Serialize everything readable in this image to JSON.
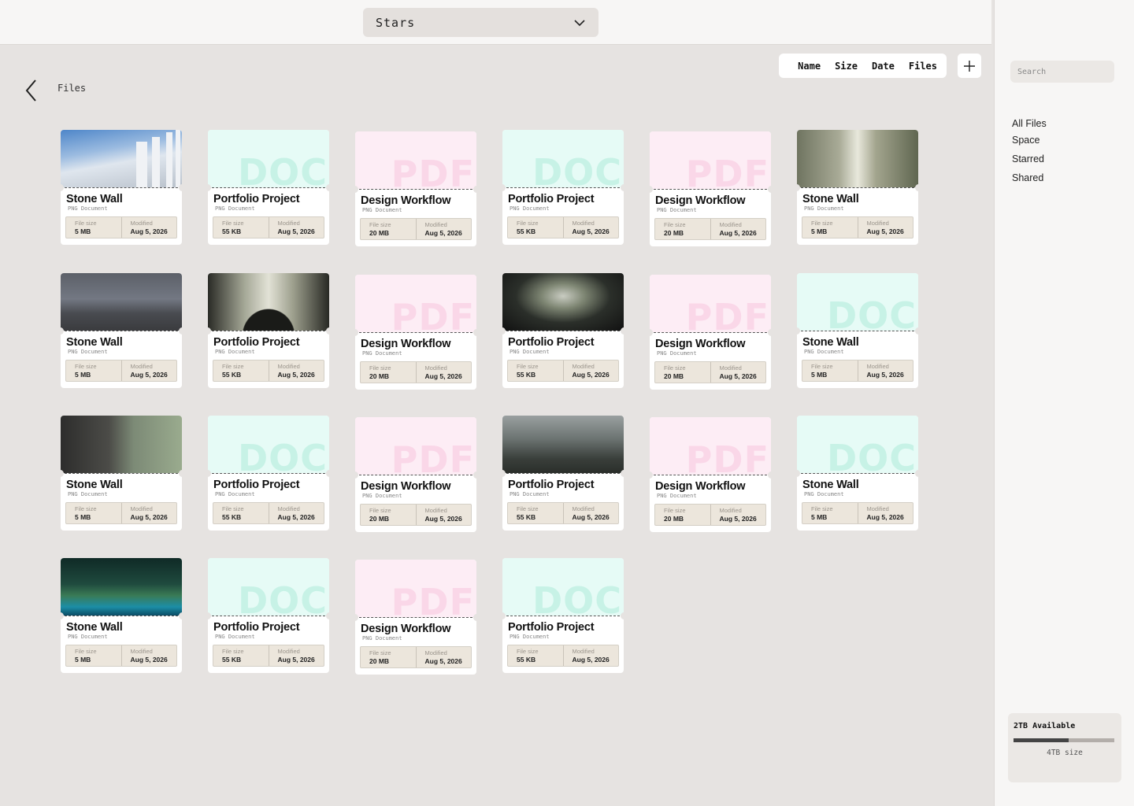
{
  "header": {
    "space_label": "Stars"
  },
  "toolbar": {
    "sort_options": [
      "Name",
      "Size",
      "Date",
      "Files"
    ]
  },
  "breadcrumb": {
    "current": "Files"
  },
  "labels": {
    "file_size": "File size",
    "modified": "Modified"
  },
  "files": [
    {
      "name": "Stone Wall",
      "type": "PNG Document",
      "size": "5 MB",
      "modified": "Aug 5, 2026",
      "thumb": "ph-sky"
    },
    {
      "name": "Portfolio Project",
      "type": "PNG Document",
      "size": "55 KB",
      "modified": "Aug 5, 2026",
      "thumb": "doc",
      "thumb_text": "DOC"
    },
    {
      "name": "Design Workflow",
      "type": "PNG Document",
      "size": "20 MB",
      "modified": "Aug 5, 2026",
      "thumb": "pdf",
      "thumb_text": "PDF"
    },
    {
      "name": "Portfolio Project",
      "type": "PNG Document",
      "size": "55 KB",
      "modified": "Aug 5, 2026",
      "thumb": "doc",
      "thumb_text": "DOC"
    },
    {
      "name": "Design Workflow",
      "type": "PNG Document",
      "size": "20 MB",
      "modified": "Aug 5, 2026",
      "thumb": "pdf",
      "thumb_text": "PDF"
    },
    {
      "name": "Stone Wall",
      "type": "PNG Document",
      "size": "5 MB",
      "modified": "Aug 5, 2026",
      "thumb": "ph-hall"
    },
    {
      "name": "Stone Wall",
      "type": "PNG Document",
      "size": "5 MB",
      "modified": "Aug 5, 2026",
      "thumb": "ph-storm"
    },
    {
      "name": "Portfolio Project",
      "type": "PNG Document",
      "size": "55 KB",
      "modified": "Aug 5, 2026",
      "thumb": "ph-arch"
    },
    {
      "name": "Design Workflow",
      "type": "PNG Document",
      "size": "20 MB",
      "modified": "Aug 5, 2026",
      "thumb": "pdf",
      "thumb_text": "PDF"
    },
    {
      "name": "Portfolio Project",
      "type": "PNG Document",
      "size": "55 KB",
      "modified": "Aug 5, 2026",
      "thumb": "ph-tunnel"
    },
    {
      "name": "Design Workflow",
      "type": "PNG Document",
      "size": "20 MB",
      "modified": "Aug 5, 2026",
      "thumb": "pdf",
      "thumb_text": "PDF"
    },
    {
      "name": "Stone Wall",
      "type": "PNG Document",
      "size": "5 MB",
      "modified": "Aug 5, 2026",
      "thumb": "doc",
      "thumb_text": "DOC"
    },
    {
      "name": "Stone Wall",
      "type": "PNG Document",
      "size": "5 MB",
      "modified": "Aug 5, 2026",
      "thumb": "ph-forest"
    },
    {
      "name": "Portfolio Project",
      "type": "PNG Document",
      "size": "55 KB",
      "modified": "Aug 5, 2026",
      "thumb": "doc",
      "thumb_text": "DOC"
    },
    {
      "name": "Design Workflow",
      "type": "PNG Document",
      "size": "20 MB",
      "modified": "Aug 5, 2026",
      "thumb": "pdf",
      "thumb_text": "PDF"
    },
    {
      "name": "Portfolio Project",
      "type": "PNG Document",
      "size": "55 KB",
      "modified": "Aug 5, 2026",
      "thumb": "ph-ruins"
    },
    {
      "name": "Design Workflow",
      "type": "PNG Document",
      "size": "20 MB",
      "modified": "Aug 5, 2026",
      "thumb": "pdf",
      "thumb_text": "PDF"
    },
    {
      "name": "Stone Wall",
      "type": "PNG Document",
      "size": "5 MB",
      "modified": "Aug 5, 2026",
      "thumb": "doc",
      "thumb_text": "DOC"
    },
    {
      "name": "Stone Wall",
      "type": "PNG Document",
      "size": "5 MB",
      "modified": "Aug 5, 2026",
      "thumb": "ph-moss"
    },
    {
      "name": "Portfolio Project",
      "type": "PNG Document",
      "size": "55 KB",
      "modified": "Aug 5, 2026",
      "thumb": "doc",
      "thumb_text": "DOC"
    },
    {
      "name": "Design Workflow",
      "type": "PNG Document",
      "size": "20 MB",
      "modified": "Aug 5, 2026",
      "thumb": "pdf",
      "thumb_text": "PDF"
    },
    {
      "name": "Portfolio Project",
      "type": "PNG Document",
      "size": "55 KB",
      "modified": "Aug 5, 2026",
      "thumb": "doc",
      "thumb_text": "DOC"
    }
  ],
  "sidebar": {
    "search_placeholder": "Search",
    "nav": [
      "All Files",
      "Space",
      "Starred",
      "Shared"
    ],
    "storage": {
      "available": "2TB Available",
      "total": "4TB size",
      "used_fraction": 0.55
    }
  },
  "colors": {
    "background": "#e6e3e1",
    "doc_tint": "#e6fbf6",
    "pdf_tint": "#fdedf5",
    "meta_bg": "#ece6dc"
  },
  "icons": {
    "dropdown": "chevron-down-icon",
    "add": "plus-icon",
    "back": "chevron-left-icon"
  }
}
